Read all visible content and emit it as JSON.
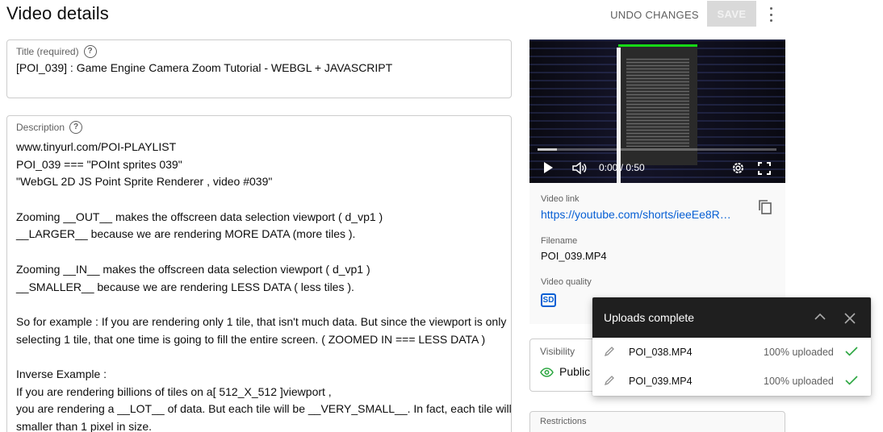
{
  "header": {
    "title": "Video details",
    "undo_label": "UNDO CHANGES",
    "save_label": "SAVE"
  },
  "title_field": {
    "label": "Title (required)",
    "value": "[POI_039] : Game Engine Camera Zoom Tutorial - WEBGL + JAVASCRIPT"
  },
  "description_field": {
    "label": "Description",
    "lines": [
      "www.tinyurl.com/POI-PLAYLIST",
      "POI_039 === \"POInt sprites 039\"",
      "\"WebGL 2D JS Point Sprite Renderer , video #039\"",
      "",
      "Zooming __OUT__ makes the offscreen data selection viewport ( d_vp1 )",
      "__LARGER__ because we are rendering MORE DATA (more tiles ).",
      "",
      "Zooming __IN__ makes the offscreen data selection viewport ( d_vp1 )",
      "__SMALLER__ because we are rendering LESS DATA ( less tiles ).",
      "",
      "So for example : If you are rendering only 1 tile, that isn't much data. But since the viewport is only",
      "selecting 1 tile, that one time is going to fill the entire screen. ( ZOOMED IN === LESS DATA )",
      "",
      "Inverse Example :",
      "If you are rendering billions of tiles on a[ 512_X_512 ]viewport ,",
      "you are rendering a __LOT__ of data. But each tile will be __VERY_SMALL__. In fact, each tile will be",
      "smaller than 1 pixel in size."
    ]
  },
  "video_player": {
    "time": "0:00 / 0:50",
    "progress": 0.08
  },
  "video_info": {
    "link_label": "Video link",
    "link_value": "https://youtube.com/shorts/ieeEe8R…",
    "filename_label": "Filename",
    "filename_value": "POI_039.MP4",
    "quality_label": "Video quality",
    "quality_badge": "SD"
  },
  "visibility": {
    "label": "Visibility",
    "value": "Public"
  },
  "restrictions": {
    "label": "Restrictions"
  },
  "uploads_popup": {
    "title": "Uploads complete",
    "items": [
      {
        "filename": "POI_038.MP4",
        "status": "100% uploaded"
      },
      {
        "filename": "POI_039.MP4",
        "status": "100% uploaded"
      }
    ]
  },
  "colors": {
    "accent_blue": "#065fd4",
    "success_green": "#2ba640",
    "popup_header": "#1f1f1f"
  }
}
